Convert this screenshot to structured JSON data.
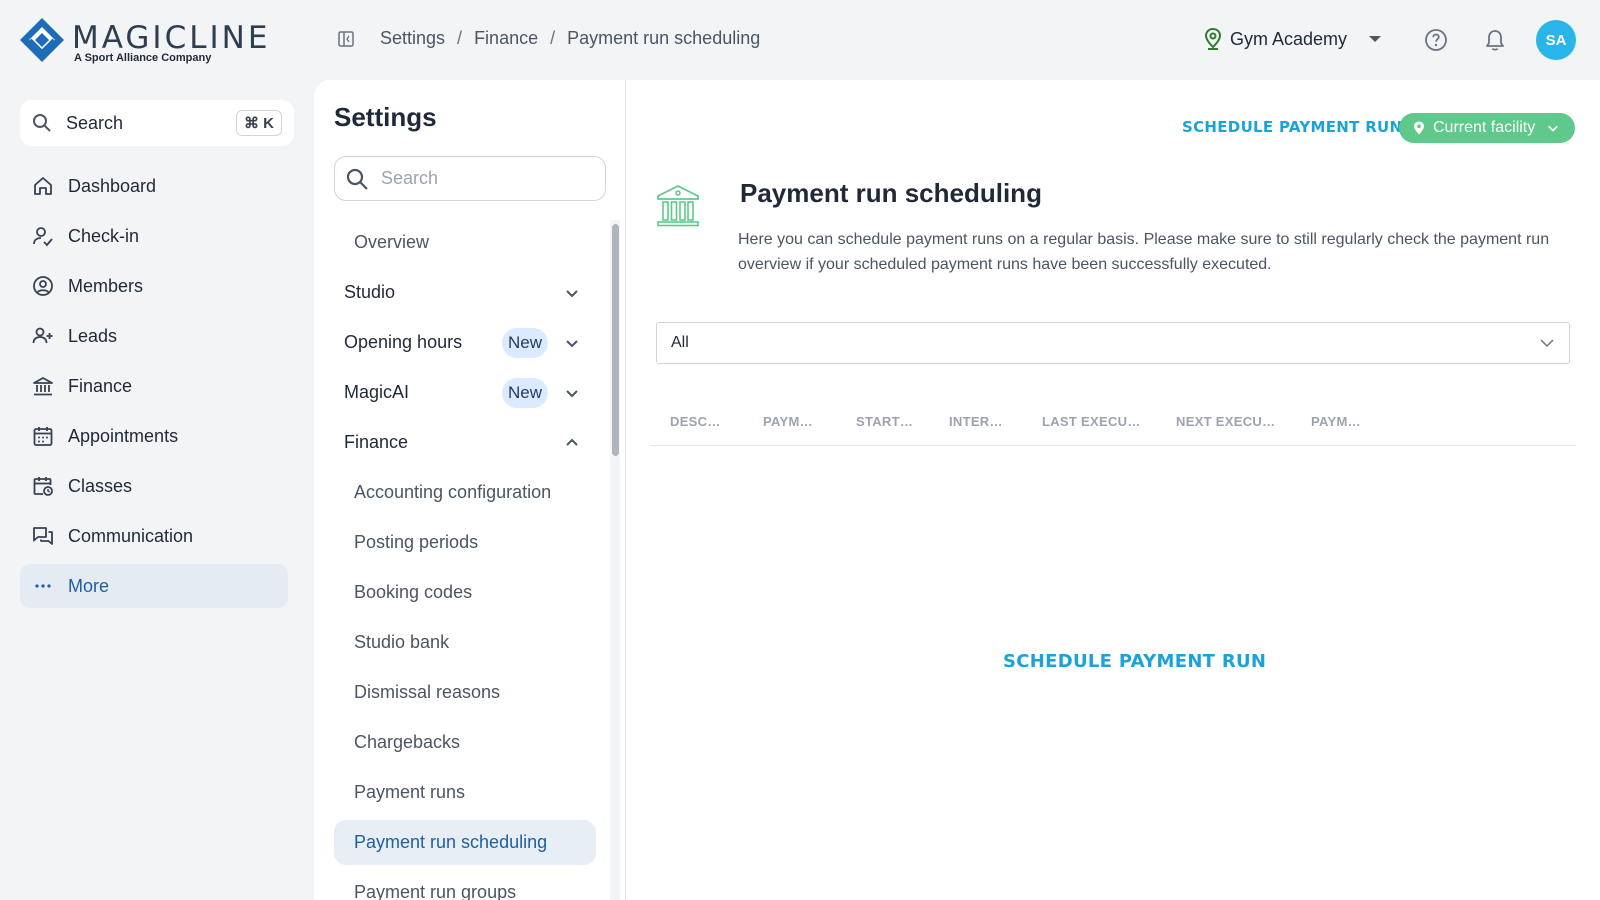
{
  "brand": {
    "name": "MAGICLINE",
    "tagline": "A Sport Alliance Company",
    "color": "#1e6bb8"
  },
  "breadcrumb": [
    "Settings",
    "Finance",
    "Payment run scheduling"
  ],
  "header": {
    "facility": "Gym Academy",
    "avatar_initials": "SA"
  },
  "nav": {
    "search_label": "Search",
    "search_shortcut": "⌘ K",
    "items": [
      {
        "label": "Dashboard",
        "icon": "home-icon"
      },
      {
        "label": "Check-in",
        "icon": "check-in-icon"
      },
      {
        "label": "Members",
        "icon": "members-icon"
      },
      {
        "label": "Leads",
        "icon": "leads-icon"
      },
      {
        "label": "Finance",
        "icon": "bank-icon"
      },
      {
        "label": "Appointments",
        "icon": "calendar-icon"
      },
      {
        "label": "Classes",
        "icon": "classes-icon"
      },
      {
        "label": "Communication",
        "icon": "chat-icon"
      },
      {
        "label": "More",
        "icon": "more-icon",
        "active": true
      }
    ]
  },
  "settings": {
    "title": "Settings",
    "search_placeholder": "Search",
    "items": [
      {
        "label": "Overview",
        "type": "sub"
      },
      {
        "label": "Studio",
        "type": "group",
        "expanded": false
      },
      {
        "label": "Opening hours",
        "type": "group",
        "badge": "New",
        "expanded": false
      },
      {
        "label": "MagicAI",
        "type": "group",
        "badge": "New",
        "expanded": false
      },
      {
        "label": "Finance",
        "type": "group",
        "expanded": true
      },
      {
        "label": "Accounting configuration",
        "type": "sub"
      },
      {
        "label": "Posting periods",
        "type": "sub"
      },
      {
        "label": "Booking codes",
        "type": "sub"
      },
      {
        "label": "Studio bank",
        "type": "sub"
      },
      {
        "label": "Dismissal reasons",
        "type": "sub"
      },
      {
        "label": "Chargebacks",
        "type": "sub"
      },
      {
        "label": "Payment runs",
        "type": "sub"
      },
      {
        "label": "Payment run scheduling",
        "type": "sub",
        "active": true
      },
      {
        "label": "Payment run groups",
        "type": "sub"
      }
    ]
  },
  "main": {
    "schedule_button": "SCHEDULE PAYMENT RUN",
    "facility_filter": "Current facility",
    "title": "Payment run scheduling",
    "description": "Here you can schedule payment runs on a regular basis. Please make sure to still regularly check the payment run overview if your scheduled payment runs have been successfully executed.",
    "filter_value": "All",
    "columns": [
      "DESC…",
      "PAYM…",
      "START…",
      "INTER…",
      "LAST EXECU…",
      "NEXT EXECU…",
      "PAYM…"
    ],
    "empty_action": "SCHEDULE PAYMENT RUN"
  },
  "colors": {
    "accent": "#1aa3d9",
    "facility_green": "#5ec98b",
    "active_nav_bg": "#e4ebf3",
    "avatar": "#29b5e8"
  }
}
